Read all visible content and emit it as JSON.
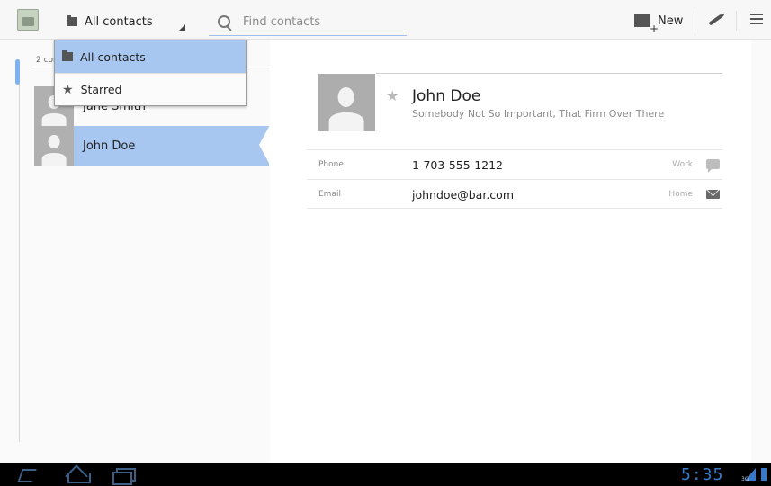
{
  "actionbar": {
    "filter_label": "All contacts",
    "search_placeholder": "Find contacts",
    "new_label": "New"
  },
  "filter_dropdown": {
    "items": [
      {
        "label": "All contacts",
        "selected": true
      },
      {
        "label": "Starred",
        "selected": false
      }
    ]
  },
  "contact_list": {
    "count_label": "2 cor",
    "items": [
      {
        "name": "Jane Smith",
        "selected": false
      },
      {
        "name": "John Doe",
        "selected": true
      }
    ]
  },
  "detail": {
    "name": "John Doe",
    "organization": "Somebody Not So Important, That Firm Over There",
    "fields": [
      {
        "label": "Phone",
        "value": "1-703-555-1212",
        "type": "Work",
        "action_icon": "sms-icon"
      },
      {
        "label": "Email",
        "value": "johndoe@bar.com",
        "type": "Home",
        "action_icon": "mail-icon"
      }
    ]
  },
  "systembar": {
    "clock": "5:35",
    "signal_label": "3G"
  },
  "colors": {
    "selection": "#a7c7f1",
    "system_accent": "#3a78c8"
  }
}
